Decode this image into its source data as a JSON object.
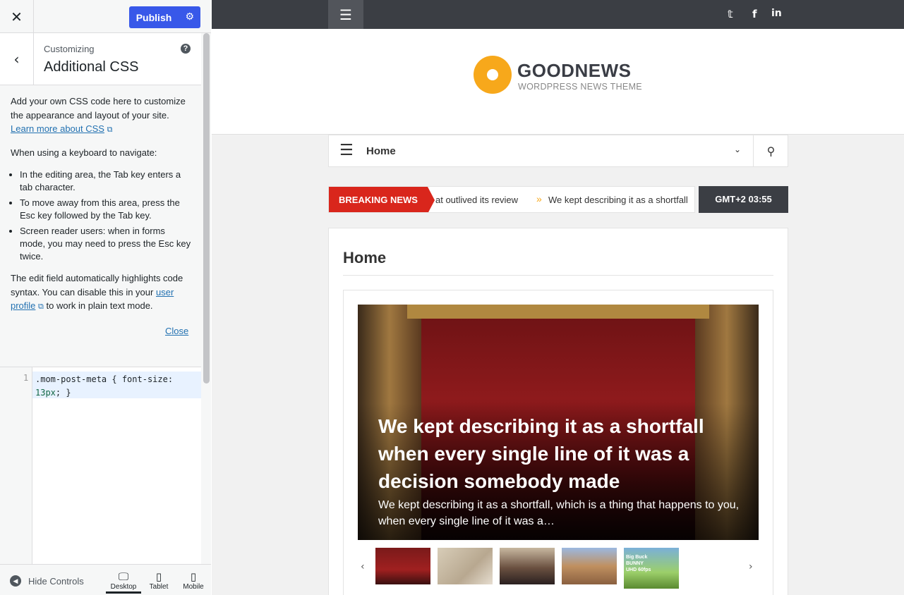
{
  "customizer": {
    "close_icon": "close-icon",
    "publish_label": "Publish",
    "customizing_label": "Customizing",
    "section_title": "Additional CSS",
    "desc_p1": "Add your own CSS code here to customize the appearance and layout of your site.",
    "learn_more_link": "Learn more about CSS",
    "keyboard_intro": "When using a keyboard to navigate:",
    "bullets": [
      "In the editing area, the Tab key enters a tab character.",
      "To move away from this area, press the Esc key followed by the Tab key.",
      "Screen reader users: when in forms mode, you may need to press the Esc key twice."
    ],
    "desc_p3_a": "The edit field automatically highlights code syntax. You can disable this in your",
    "user_profile_link": "user profile",
    "desc_p3_b": "to work in plain text mode.",
    "close_link": "Close",
    "code_line_number": "1",
    "code_part1": ".mom-post-meta { font-size:",
    "code_num": "13px",
    "code_part2": "; }",
    "hide_controls": "Hide Controls",
    "devices": [
      "Desktop",
      "Tablet",
      "Mobile"
    ],
    "active_device": "Desktop"
  },
  "site": {
    "logo_title": "GOODNEWS",
    "logo_subtitle": "WORDPRESS NEWS THEME",
    "nav_home": "Home",
    "breaking_label": "BREAKING NEWS",
    "ticker_1": "at outlived its review",
    "ticker_2": "We kept describing it as a shortfall",
    "clock": "GMT+2 03:55",
    "page_heading": "Home",
    "hero_title": "We kept describing it as a shortfall when every single line of it was a decision somebody made",
    "hero_excerpt": "We kept describing it as a shortfall, which is a thing that happens to you, when every single line of it was a…",
    "thumb_5_text": "Big Buck BUNNY UHD 60fps"
  }
}
